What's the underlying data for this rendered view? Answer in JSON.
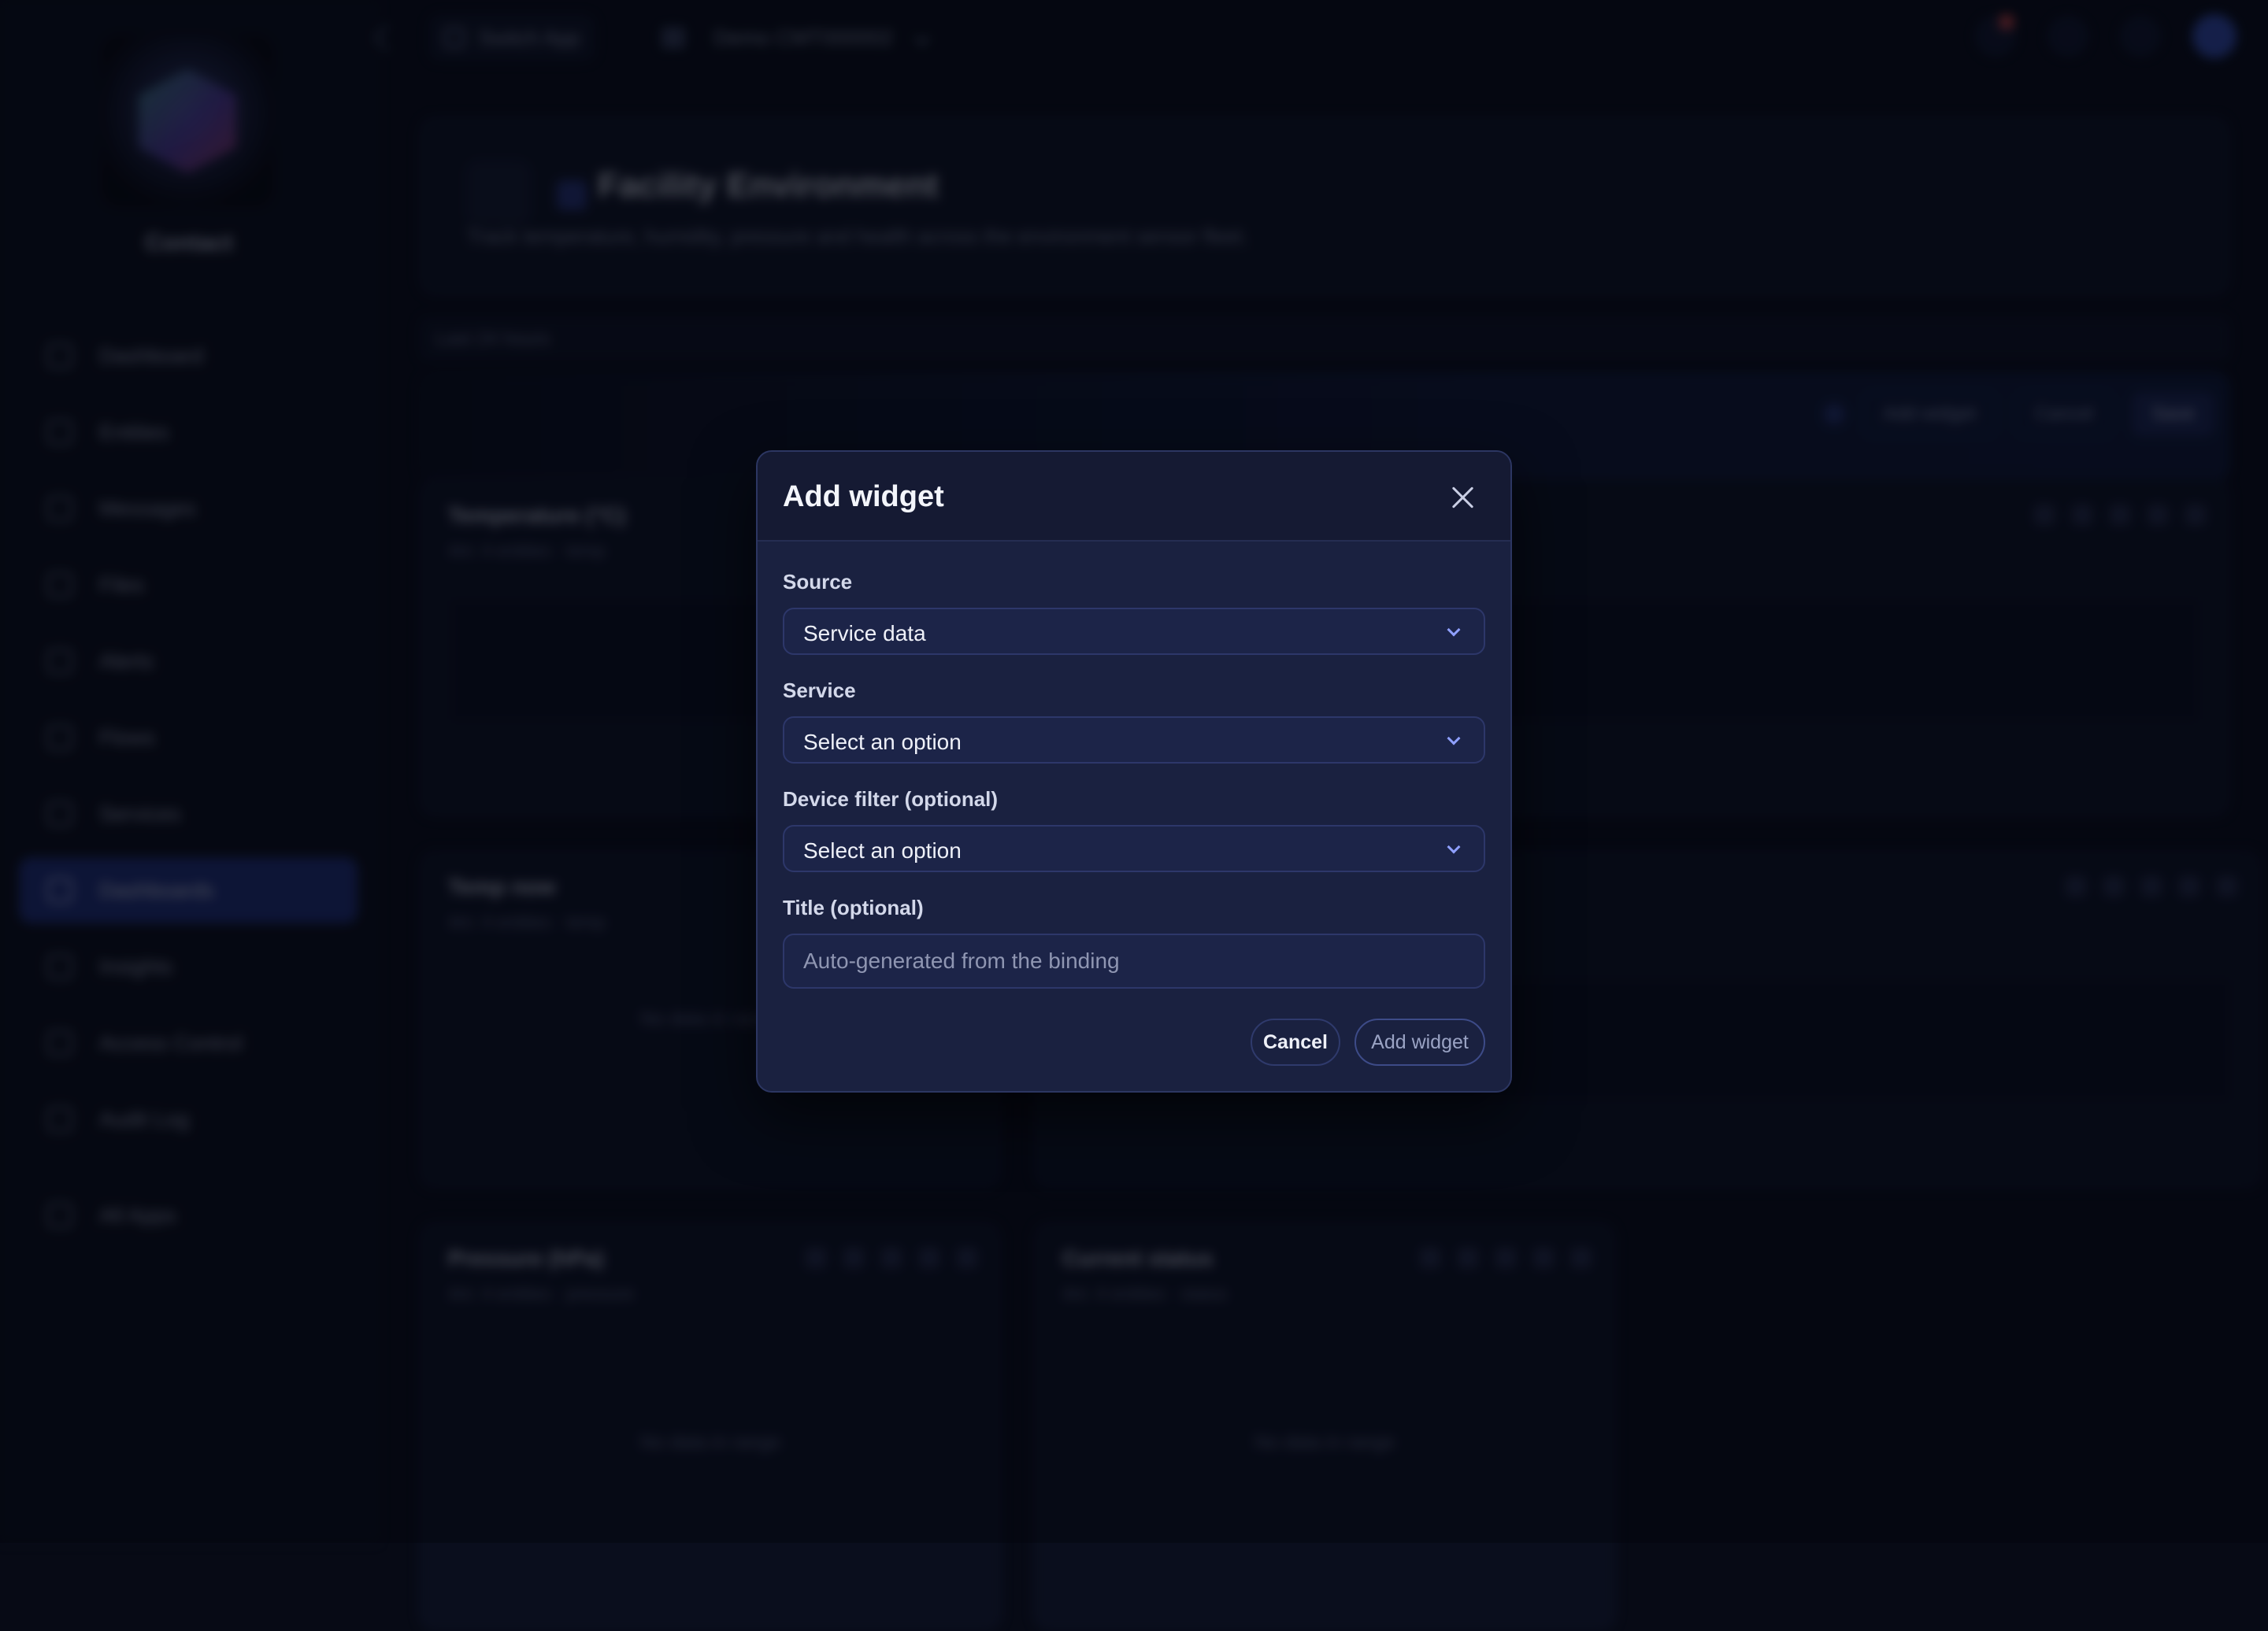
{
  "background": {
    "brand": "Contact",
    "nav": [
      {
        "label": "Dashboard",
        "icon": "grid-icon"
      },
      {
        "label": "Entities",
        "icon": "entities-icon"
      },
      {
        "label": "Messages",
        "icon": "message-icon"
      },
      {
        "label": "Files",
        "icon": "folder-icon"
      },
      {
        "label": "Alerts",
        "icon": "bell-icon"
      },
      {
        "label": "Flows",
        "icon": "flow-icon"
      },
      {
        "label": "Services",
        "icon": "services-icon"
      },
      {
        "label": "Dashboards",
        "icon": "dashboard-icon",
        "active": true
      },
      {
        "label": "Insights",
        "icon": "insights-icon"
      },
      {
        "label": "Access Control",
        "icon": "lock-icon"
      },
      {
        "label": "Audit Log",
        "icon": "log-icon"
      },
      {
        "label": "All Apps",
        "icon": "apps-icon"
      }
    ],
    "topbar": {
      "switch_app": "Switch App",
      "tenant": "Demo CMT000002"
    },
    "page": {
      "title": "Facility Environment",
      "description": "Track temperature, humidity, pressure and health across the environment sensor fleet.",
      "range": "Last 24 hours"
    },
    "edit_actions": {
      "add_widget": "Add widget",
      "cancel": "Cancel",
      "save": "Save"
    },
    "widgets": [
      {
        "title": "Temperature (°C)",
        "subtitle": "4m: 4 entities · temp"
      },
      {
        "title": "Temp now",
        "subtitle": "4m: 4 entities · temp",
        "empty": "No data in range"
      },
      {
        "title": "Pressure (hPa)",
        "subtitle": "4m: 4 entities · pressure",
        "empty": "No data in range"
      },
      {
        "title": "Current status",
        "subtitle": "4m: 4 entities · status",
        "empty": "No data in range"
      }
    ]
  },
  "modal": {
    "title": "Add widget",
    "fields": {
      "source": {
        "label": "Source",
        "value": "Service data"
      },
      "service": {
        "label": "Service",
        "value": "Select an option"
      },
      "device_filter": {
        "label": "Device filter (optional)",
        "value": "Select an option"
      },
      "title": {
        "label": "Title (optional)",
        "value": "",
        "placeholder": "Auto-generated from the binding"
      }
    },
    "buttons": {
      "cancel": "Cancel",
      "add": "Add widget"
    }
  },
  "colors": {
    "accent": "#8fa0ff",
    "modal_bg": "#1a2140",
    "active_nav": "#22348a"
  }
}
